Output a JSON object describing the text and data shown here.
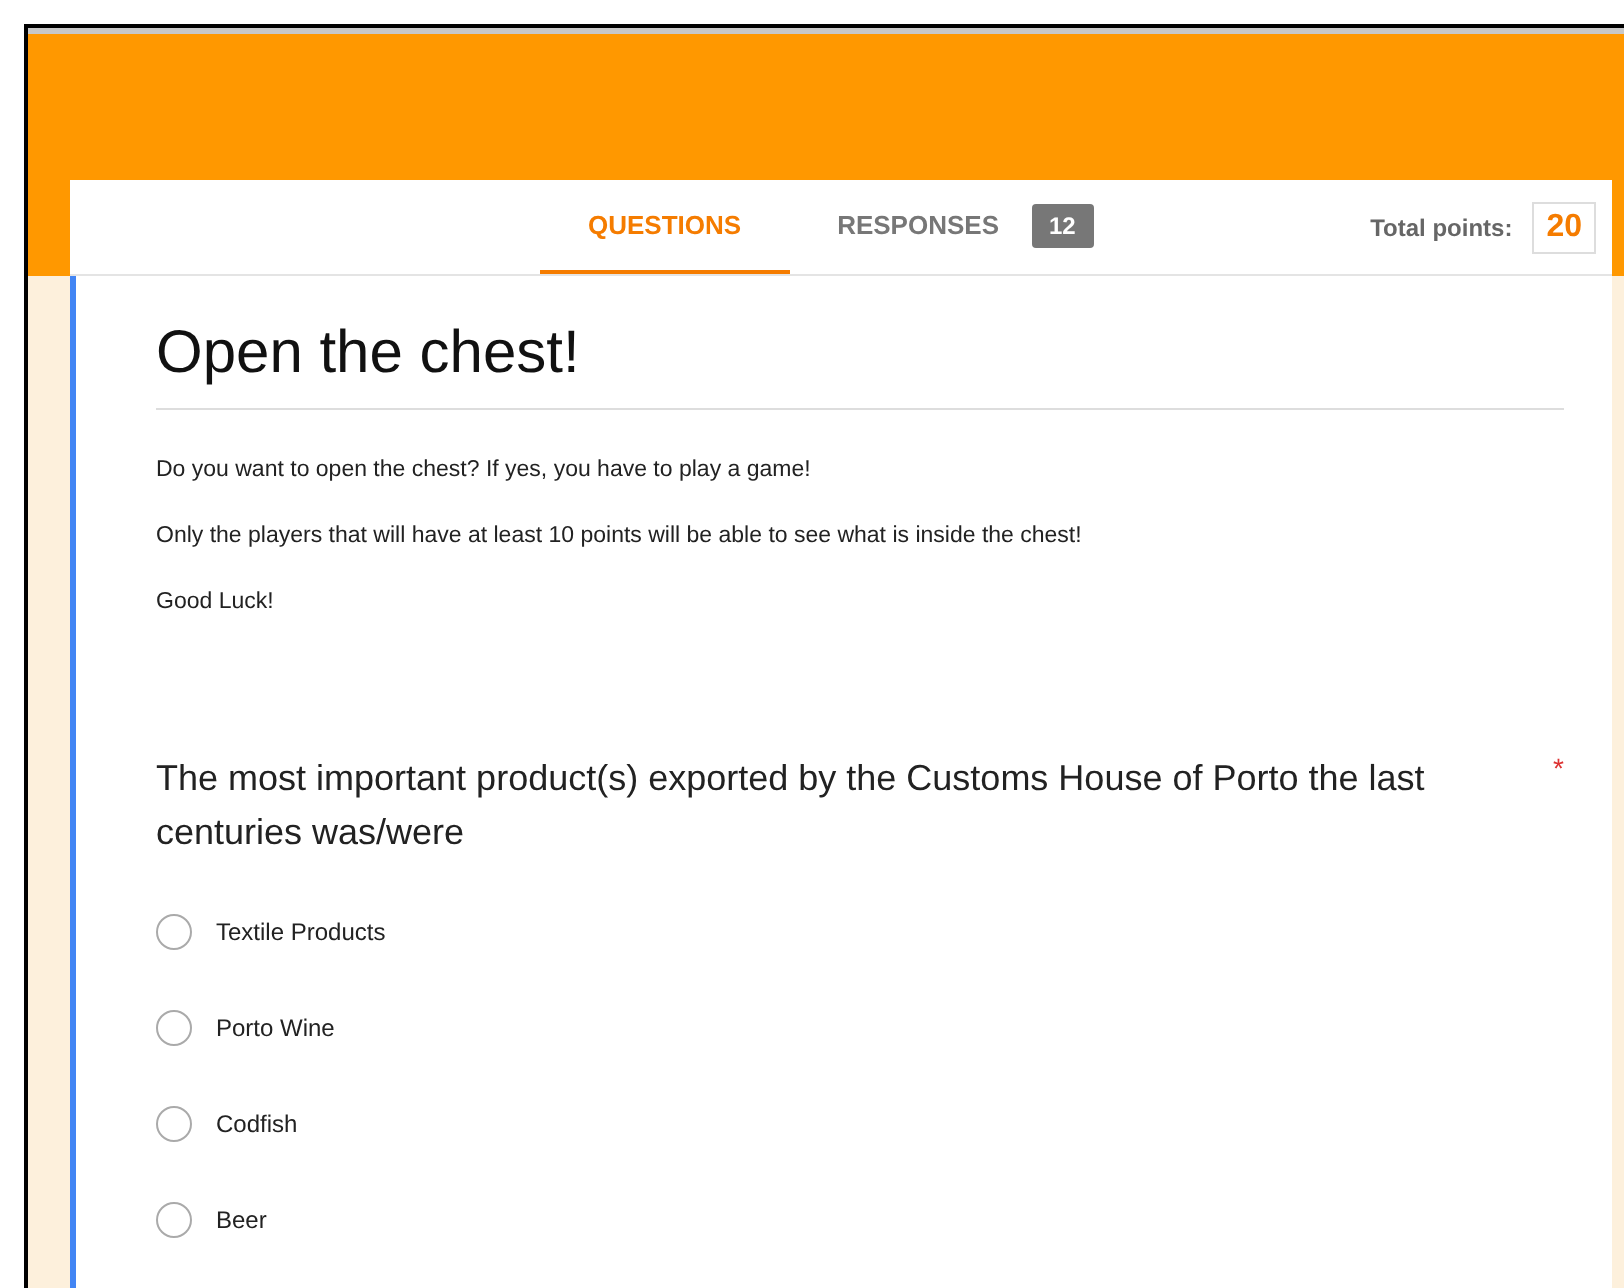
{
  "tabs": [
    {
      "label": "QUESTIONS",
      "selected": true
    },
    {
      "label": "RESPONSES",
      "selected": false,
      "badge": "12"
    }
  ],
  "total_points": {
    "label": "Total points:",
    "value": "20"
  },
  "form": {
    "title": "Open the chest!",
    "description": [
      "Do you want to open the chest? If yes, you have to play a game!",
      "Only the players that will have at least 10 points will be able to see what is inside the chest!",
      "Good Luck!"
    ]
  },
  "question": {
    "text": "The most important product(s) exported by the Customs House of Porto the last centuries was/were",
    "required": true,
    "required_mark": "*",
    "options": [
      {
        "label": "Textile Products",
        "selected": false
      },
      {
        "label": "Porto Wine",
        "selected": false
      },
      {
        "label": "Codfish",
        "selected": false
      },
      {
        "label": "Beer",
        "selected": false
      }
    ]
  }
}
